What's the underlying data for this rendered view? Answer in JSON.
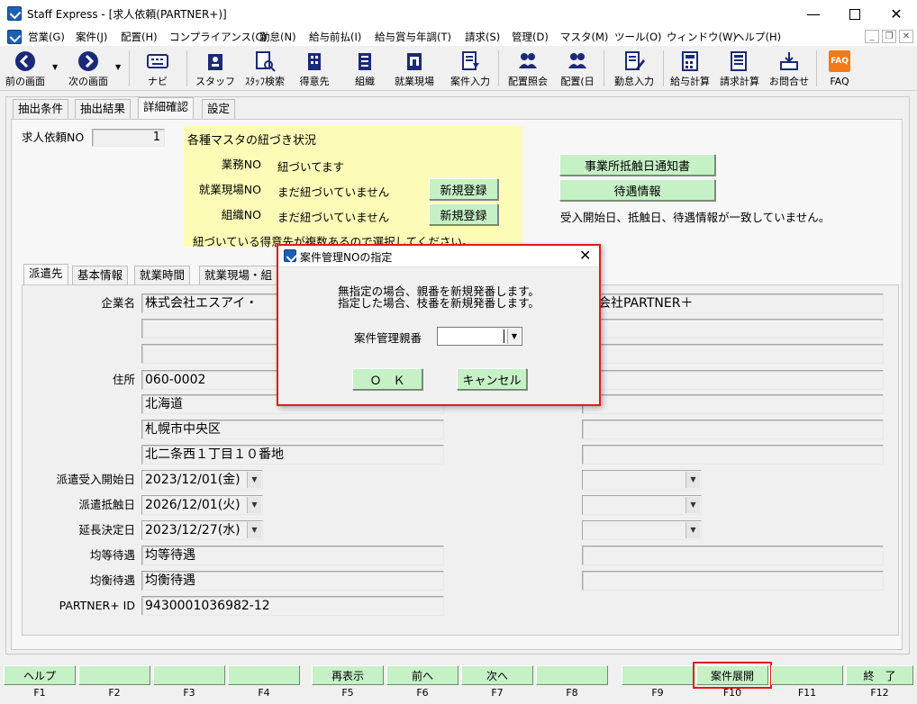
{
  "window": {
    "title": "Staff Express - [求人依頼(PARTNER+)]"
  },
  "menu": [
    "営業(G)",
    "案件(J)",
    "配置(H)",
    "コンプライアンス(C)",
    "勤怠(N)",
    "給与前払(I)",
    "給与賞与年調(T)",
    "請求(S)",
    "管理(D)",
    "マスタ(M)",
    "ツール(O)",
    "ウィンドウ(W)",
    "ヘルプ(H)"
  ],
  "toolbar": {
    "back": "前の画面",
    "forward": "次の画面",
    "navi": "ナビ",
    "staff": "スタッフ",
    "staff_search": "ｽﾀｯﾌ検索",
    "client": "得意先",
    "org": "組織",
    "workplace": "就業現場",
    "case_input": "案件入力",
    "assign_inquiry": "配置照会",
    "assign_day": "配置(日",
    "attendance_input": "勤怠入力",
    "payroll": "給与計算",
    "billing": "請求計算",
    "inquiry": "お問合せ",
    "faq": "FAQ",
    "faq_icon_text": "FAQ"
  },
  "top_tabs": [
    "抽出条件",
    "抽出結果",
    "詳細確認",
    "設定"
  ],
  "request_no": {
    "label": "求人依頼NO",
    "value": "1"
  },
  "master_link": {
    "title": "各種マスタの紐づき状況",
    "rows": [
      {
        "label": "業務NO",
        "status": "紐づいてます"
      },
      {
        "label": "就業現場NO",
        "status": "まだ紐づいていません",
        "button": "新規登録"
      },
      {
        "label": "組織NO",
        "status": "まだ紐づいていません",
        "button": "新規登録"
      }
    ],
    "note": "紐づいている得意先が複数あるので選択してください。"
  },
  "right_buttons": {
    "notice": "事業所抵触日通知書",
    "treatment": "待遇情報"
  },
  "warning_text": "受入開始日、抵触日、待遇情報が一致していません。",
  "sub_tabs": [
    "派遣先",
    "基本情報",
    "就業時間",
    "就業現場・組"
  ],
  "form": {
    "company_label": "企業名",
    "company_value": "株式会社エスアイ・",
    "company_right": "式会社PARTNER＋",
    "address_label": "住所",
    "zip": "060-0002",
    "pref": "北海道",
    "city": "札幌市中央区",
    "street": "北二条西１丁目１０番地",
    "start_label": "派遣受入開始日",
    "start_value": "2023/12/01(金)",
    "conflict_label": "派遣抵触日",
    "conflict_value": "2026/12/01(火)",
    "extend_label": "延長決定日",
    "extend_value": "2023/12/27(水)",
    "equal_label": "均等待遇",
    "equal_value": "均等待遇",
    "balance_label": "均衡待遇",
    "balance_value": "均衡待遇",
    "partner_label": "PARTNER+ ID",
    "partner_value": "9430001036982-12"
  },
  "dialog": {
    "title": "案件管理NOの指定",
    "line1": "無指定の場合、親番を新規発番します。",
    "line2": "指定した場合、枝番を新規発番します。",
    "field_label": "案件管理親番",
    "ok": "Ｏ　Ｋ",
    "cancel": "キャンセル"
  },
  "fkeys": [
    {
      "label": "ヘルプ",
      "key": "F1"
    },
    {
      "label": "",
      "key": "F2"
    },
    {
      "label": "",
      "key": "F3"
    },
    {
      "label": "",
      "key": "F4"
    },
    {
      "label": "再表示",
      "key": "F5"
    },
    {
      "label": "前へ",
      "key": "F6"
    },
    {
      "label": "次へ",
      "key": "F7"
    },
    {
      "label": "",
      "key": "F8"
    },
    {
      "label": "",
      "key": "F9"
    },
    {
      "label": "案件展開",
      "key": "F10"
    },
    {
      "label": "",
      "key": "F11"
    },
    {
      "label": "終　了",
      "key": "F12"
    }
  ],
  "colors": {
    "highlight": "#e01b1b",
    "green_button": "#c6f0c6",
    "yellow_panel": "#fdfcb7"
  }
}
